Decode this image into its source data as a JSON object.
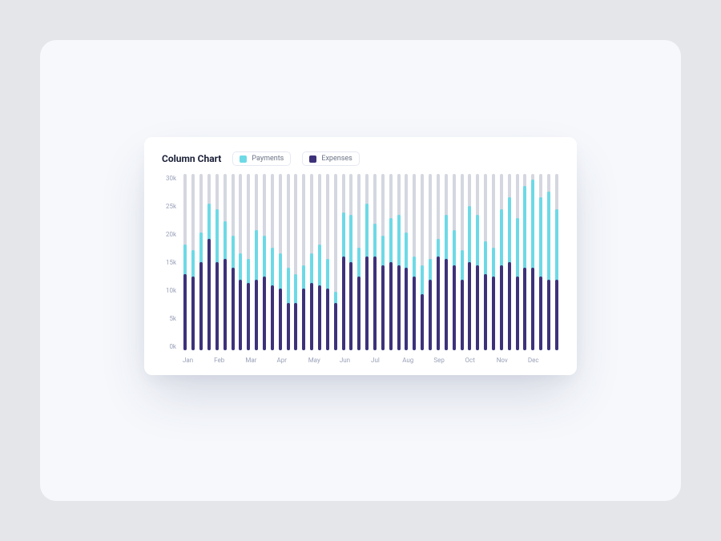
{
  "title": "Column Chart",
  "legend": {
    "payments": {
      "label": "Payments",
      "color": "#6ed9e6"
    },
    "expenses": {
      "label": "Expenses",
      "color": "#3d327a"
    }
  },
  "y_ticks": [
    "30k",
    "25k",
    "20k",
    "15k",
    "10k",
    "5k",
    "0k"
  ],
  "x_ticks": [
    "Jan",
    "Feb",
    "Mar",
    "Apr",
    "May",
    "Jun",
    "Jul",
    "Aug",
    "Sep",
    "Oct",
    "Nov",
    "Dec"
  ],
  "colors": {
    "track": "#d4d7e0",
    "payments": "#6ed9e6",
    "expenses": "#3d327a",
    "card_bg": "#ffffff",
    "page_bg": "#f6f8fc"
  },
  "chart_data": {
    "type": "bar",
    "title": "Column Chart",
    "ylabel": "",
    "xlabel": "",
    "ylim": [
      0,
      30000
    ],
    "x": [
      1,
      2,
      3,
      4,
      5,
      6,
      7,
      8,
      9,
      10,
      11,
      12,
      13,
      14,
      15,
      16,
      17,
      18,
      19,
      20,
      21,
      22,
      23,
      24,
      25,
      26,
      27,
      28,
      29,
      30,
      31,
      32,
      33,
      34,
      35,
      36,
      37,
      38,
      39,
      40,
      41,
      42,
      43,
      44,
      45,
      46,
      47,
      48
    ],
    "month_labels_at": {
      "1": "Jan",
      "5": "Feb",
      "9": "Mar",
      "13": "Apr",
      "17": "May",
      "21": "Jun",
      "25": "Jul",
      "29": "Aug",
      "33": "Sep",
      "37": "Oct",
      "41": "Nov",
      "45": "Dec"
    },
    "series": [
      {
        "name": "Payments",
        "color": "#6ed9e6",
        "values": [
          18000,
          17000,
          20000,
          25000,
          24000,
          22000,
          19500,
          16500,
          15500,
          20500,
          19500,
          17500,
          16500,
          14000,
          13000,
          14500,
          16500,
          18000,
          15500,
          10000,
          23500,
          23000,
          17500,
          25000,
          21500,
          19500,
          22500,
          23000,
          20000,
          16000,
          14500,
          15500,
          19000,
          23000,
          20500,
          17000,
          24500,
          23000,
          18500,
          17500,
          24000,
          26000,
          22500,
          28000,
          29000,
          26000,
          27000,
          24000
        ]
      },
      {
        "name": "Expenses",
        "color": "#3d327a",
        "values": [
          13000,
          12500,
          15000,
          19000,
          15000,
          15500,
          14000,
          12000,
          11500,
          12000,
          12500,
          11000,
          10500,
          8000,
          8000,
          10500,
          11500,
          11000,
          10500,
          8000,
          16000,
          15000,
          12500,
          16000,
          16000,
          14500,
          15000,
          14500,
          14000,
          12500,
          9500,
          12000,
          16000,
          15500,
          14500,
          12000,
          15000,
          14500,
          13000,
          12500,
          14500,
          15000,
          12500,
          14000,
          14000,
          12500,
          12000,
          12000
        ]
      }
    ]
  }
}
